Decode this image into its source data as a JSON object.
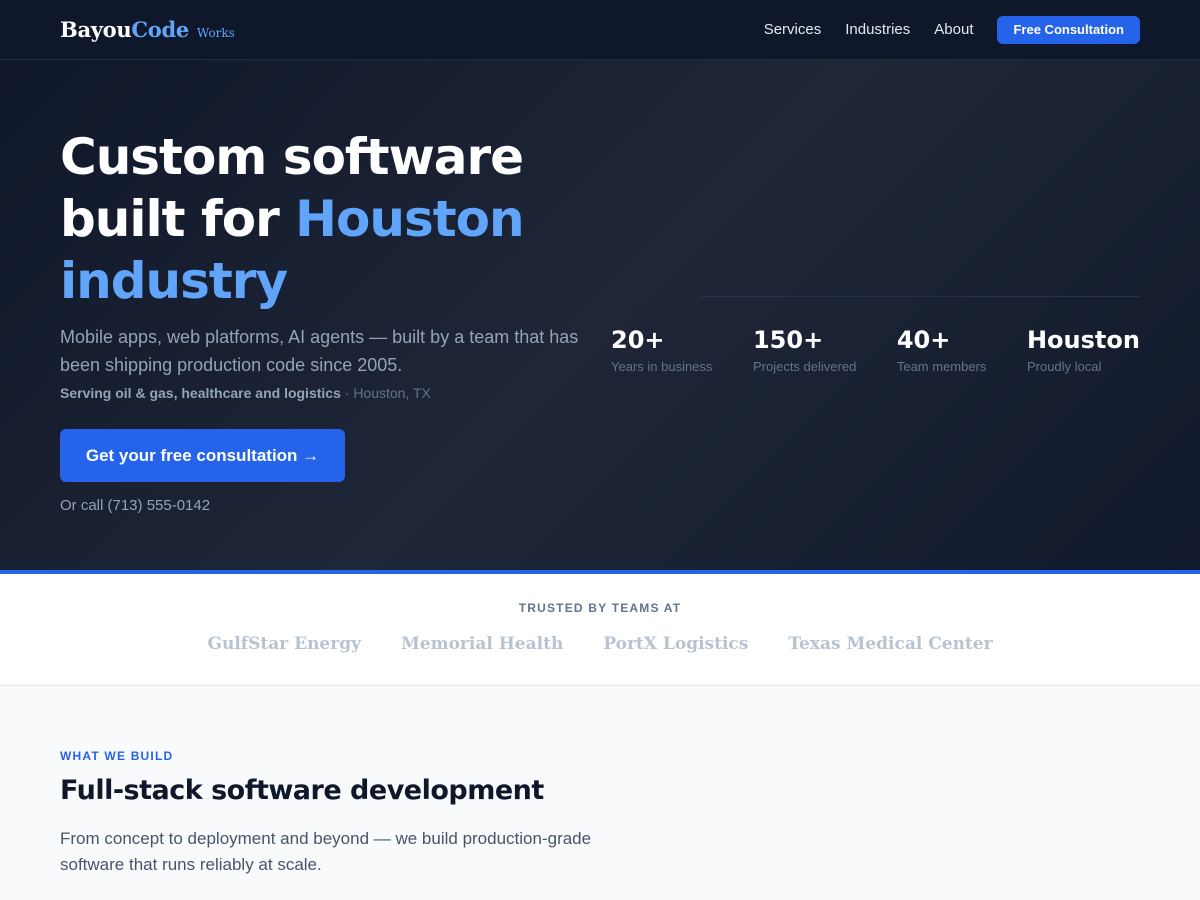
{
  "nav": {
    "logo": {
      "part1": "Bayou",
      "part2": "Code",
      "suffix": "Works"
    },
    "links": [
      "Services",
      "Industries",
      "About"
    ],
    "cta": "Free Consultation"
  },
  "hero": {
    "title_line1": "Custom software",
    "title_line2_plain": "built for ",
    "title_line2_highlight": "Houston",
    "title_line3_highlight": "industry",
    "description": "Mobile apps, web platforms, AI agents — built by a team that has been shipping production code since 2005.",
    "serving_strong": "Serving oil & gas, healthcare and logistics",
    "serving_location": " · Houston, TX",
    "cta": "Get your free consultation →",
    "call": "Or call (713) 555-0142"
  },
  "stats": [
    {
      "value": "20+",
      "label": "Years in business"
    },
    {
      "value": "150+",
      "label": "Projects delivered"
    },
    {
      "value": "40+",
      "label": "Team members"
    },
    {
      "value": "Houston",
      "label": "Proudly local"
    }
  ],
  "trusted": {
    "title": "TRUSTED BY TEAMS AT",
    "logos": [
      "GulfStar Energy",
      "Memorial Health",
      "PortX Logistics",
      "Texas Medical Center"
    ]
  },
  "build": {
    "eyebrow": "WHAT WE BUILD",
    "title": "Full-stack software development",
    "description": "From concept to deployment and beyond — we build production-grade software that runs reliably at scale."
  },
  "colors": {
    "accent": "#2563eb",
    "highlight": "#60a5fa",
    "navy": "#0f172a"
  }
}
